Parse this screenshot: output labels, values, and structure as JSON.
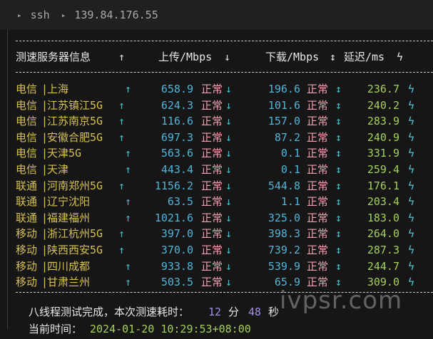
{
  "window": {
    "breadcrumb": [
      "ssh",
      "139.84.176.55"
    ]
  },
  "table": {
    "header": {
      "server": "测速服务器信息",
      "up_label": "上传/Mbps",
      "down_label": "下载/Mbps",
      "latency_label": "延迟/ms"
    },
    "status_text": "正常",
    "rows": [
      {
        "isp": "电信",
        "city": "上海",
        "up": "658.9",
        "down": "196.6",
        "latency": "236.7"
      },
      {
        "isp": "电信",
        "city": "江苏镇江5G",
        "up": "624.3",
        "down": "101.6",
        "latency": "240.2"
      },
      {
        "isp": "电信",
        "city": "江苏南京5G",
        "up": "116.6",
        "down": "157.0",
        "latency": "283.9"
      },
      {
        "isp": "电信",
        "city": "安徽合肥5G",
        "up": "697.3",
        "down": "87.2",
        "latency": "240.9"
      },
      {
        "isp": "电信",
        "city": "天津5G",
        "up": "563.6",
        "down": "0.1",
        "latency": "331.9"
      },
      {
        "isp": "电信",
        "city": "天津",
        "up": "443.4",
        "down": "0.1",
        "latency": "259.4"
      },
      {
        "isp": "联通",
        "city": "河南郑州5G",
        "up": "1156.2",
        "down": "544.8",
        "latency": "176.1"
      },
      {
        "isp": "联通",
        "city": "辽宁沈阳",
        "up": "63.5",
        "down": "1.1",
        "latency": "203.4"
      },
      {
        "isp": "联通",
        "city": "福建福州",
        "up": "1021.6",
        "down": "325.0",
        "latency": "183.0"
      },
      {
        "isp": "移动",
        "city": "浙江杭州5G",
        "up": "397.0",
        "down": "398.3",
        "latency": "264.0"
      },
      {
        "isp": "移动",
        "city": "陕西西安5G",
        "up": "370.0",
        "down": "739.2",
        "latency": "287.3"
      },
      {
        "isp": "移动",
        "city": "四川成都",
        "up": "933.8",
        "down": "539.9",
        "latency": "244.7"
      },
      {
        "isp": "移动",
        "city": "甘肃兰州",
        "up": "503.5",
        "down": "65.9",
        "latency": "309.0"
      }
    ]
  },
  "footer": {
    "summary_prefix": "八线程测试完成，本次测速耗时：",
    "minutes": "12",
    "minutes_unit": "分",
    "seconds": "48",
    "seconds_unit": "秒",
    "time_label": "当前时间：",
    "time_value": "2024-01-20 10:29:53+08:00"
  },
  "watermark": "ivpsr.com",
  "icons": {
    "up_arrow": "↑",
    "down_arrow": "↓",
    "updown_arrow": "↕",
    "bolt": "ϟ",
    "breadcrumb_arrow": "▸"
  }
}
